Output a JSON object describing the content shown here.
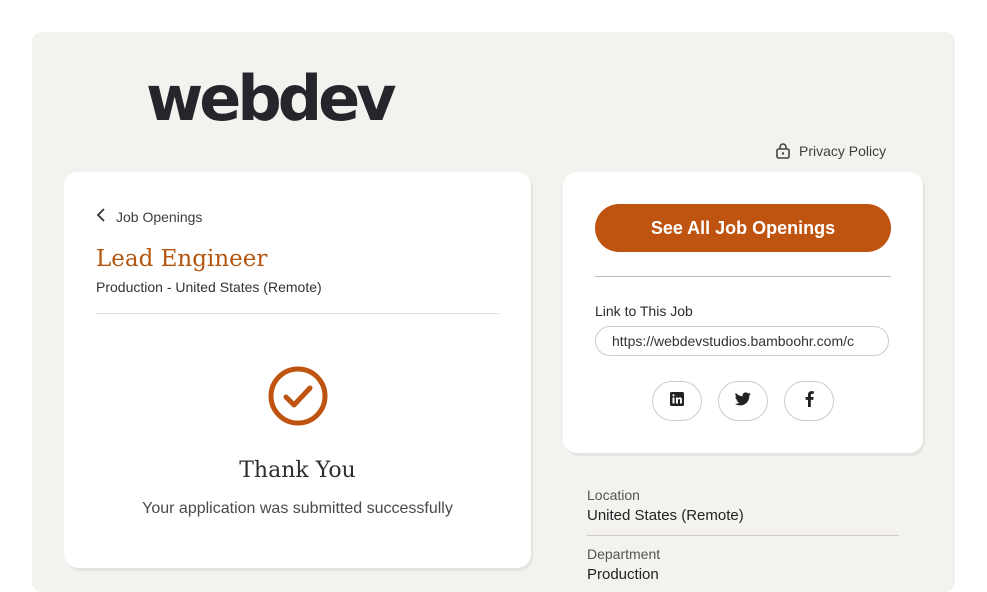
{
  "brand": {
    "logo_text": "webdev"
  },
  "header": {
    "privacy_label": "Privacy Policy"
  },
  "job": {
    "back_label": "Job Openings",
    "title": "Lead Engineer",
    "subtitle": "Production - United States (Remote)"
  },
  "confirmation": {
    "heading": "Thank You",
    "message": "Your application was submitted successfully"
  },
  "sidebar": {
    "see_all_label": "See All Job Openings",
    "link_label": "Link to This Job",
    "link_value": "https://webdevstudios.bamboohr.com/c",
    "share_icons": [
      "linkedin-icon",
      "twitter-icon",
      "facebook-icon"
    ]
  },
  "details": {
    "location_label": "Location",
    "location_value": "United States (Remote)",
    "department_label": "Department",
    "department_value": "Production"
  },
  "colors": {
    "accent": "#bf5410",
    "title": "#b5560f",
    "background": "#f4f2ef"
  }
}
